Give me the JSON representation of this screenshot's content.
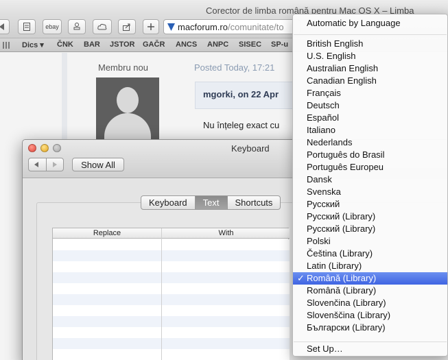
{
  "browser": {
    "title": "Corector de limba română pentru Mac OS X – Limba",
    "url_domain": "macforum.ro",
    "url_path": "/comunitate/to",
    "toolbar_ebay_label": "ebay",
    "bookmarks": [
      "Dics ▾",
      "ČNK",
      "BAR",
      "JSTOR",
      "GAČR",
      "ANCS",
      "ANPC",
      "SISEC",
      "SP-u"
    ]
  },
  "post": {
    "member_label": "Membru nou",
    "posted_label": "Posted Today, 17:21",
    "quote_author": "mgorki, on 22 Apr",
    "text": "Nu înțeleg exact cu"
  },
  "keyboard_window": {
    "title": "Keyboard",
    "show_all_label": "Show All",
    "tabs": [
      "Keyboard",
      "Text",
      "Shortcuts"
    ],
    "selected_tab": "Text",
    "table_headers": {
      "replace": "Replace",
      "with": "With"
    }
  },
  "language_menu": {
    "header": "Automatic by Language",
    "items": [
      "British English",
      "U.S. English",
      "Australian English",
      "Canadian English",
      "Français",
      "Deutsch",
      "Español",
      "Italiano",
      "Nederlands",
      "Português do Brasil",
      "Português Europeu",
      "Dansk",
      "Svenska",
      "Русский",
      "Русский (Library)",
      "Русский (Library)",
      "Polski",
      "Čeština (Library)",
      "Latin (Library)",
      "Română (Library)",
      "Română (Library)",
      "Slovenčina (Library)",
      "Slovenščina (Library)",
      "Български (Library)"
    ],
    "selected_index": 19,
    "check_mark": "✓",
    "footer": "Set Up…"
  }
}
